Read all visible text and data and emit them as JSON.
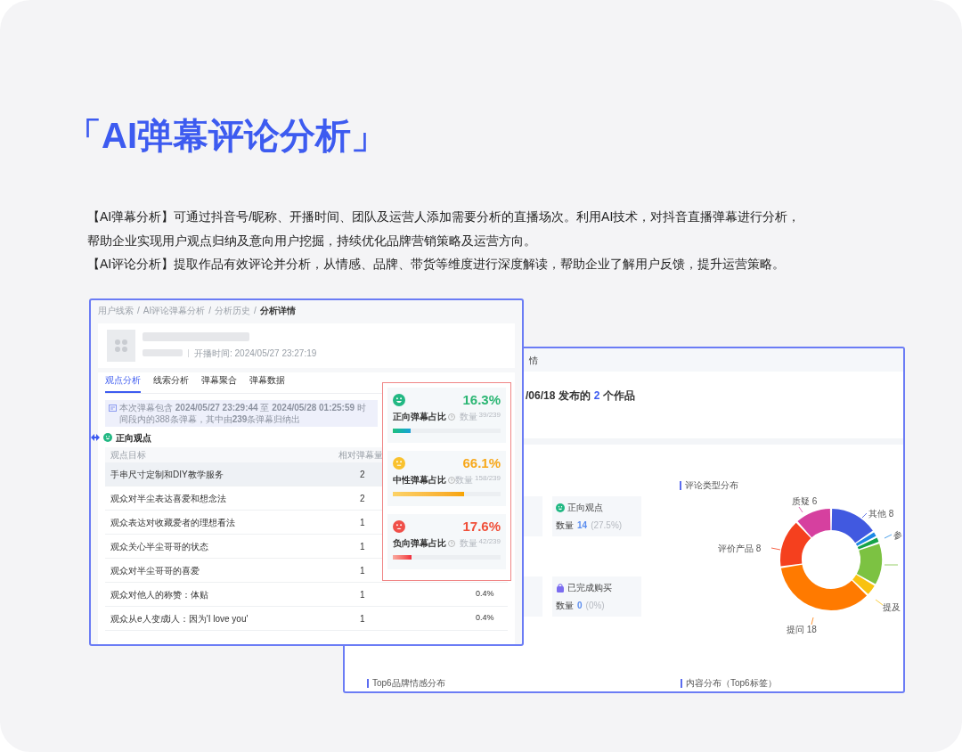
{
  "heading": "「AI弹幕评论分析」",
  "paragraphs": [
    "【AI弹幕分析】可通过抖音号/昵称、开播时间、团队及运营人添加需要分析的直播场次。利用AI技术，对抖音直播弹幕进行分析，帮助企业实现用户观点归纳及意向用户挖掘，持续优化品牌营销策略及运营方向。",
    "【AI评论分析】提取作品有效评论并分析，从情感、品牌、带货等维度进行深度解读，帮助企业了解用户反馈，提升运营策略。"
  ],
  "danmaku_window": {
    "breadcrumb": [
      {
        "label": "用户线索",
        "separator": "/"
      },
      {
        "label": "AI评论弹幕分析",
        "separator": "/"
      },
      {
        "label": "分析历史",
        "separator": "/"
      },
      {
        "label": "分析详情"
      }
    ],
    "live_time": "开播时间: 2024/05/27 23:27:19",
    "tabs": [
      {
        "label": "观点分析",
        "selected": true
      },
      {
        "label": "线索分析",
        "selected": false
      },
      {
        "label": "弹幕聚合",
        "selected": false
      },
      {
        "label": "弹幕数据",
        "selected": false
      }
    ],
    "notice": "本次弹幕包含 **2024/05/27 23:29:44** 至 **2024/05/28 01:25:59** 时间段内的388条弹幕，其中由**239**条弹幕归纳出",
    "section": "正向观点",
    "table": {
      "columns": [
        "观点目标",
        "相对弹幕量"
      ],
      "rows": [
        {
          "target": "手串尺寸定制和DIY教学服务",
          "count": "2",
          "selected": true
        },
        {
          "target": "观众对半尘表达喜爱和想念法",
          "count": "2",
          "selected": false
        },
        {
          "target": "观众表达对收藏爱者的理想看法",
          "count": "1",
          "selected": false
        },
        {
          "target": "观众关心半尘哥哥的状态",
          "count": "1",
          "selected": false
        },
        {
          "target": "观众对半尘哥哥的喜爱",
          "count": "1",
          "selected": false
        },
        {
          "target": "观众对他人的称赞：体贴",
          "count": "1",
          "share": "0.4%",
          "selected": false
        },
        {
          "target": "观众从e人变成i人：因为'I love you'",
          "count": "1",
          "share": "0.4%",
          "selected": false
        }
      ]
    },
    "sentiments": [
      {
        "kind": "positive",
        "label": "正向弹幕占比",
        "percent": "16.3%",
        "count_label": "数量",
        "count": "39/239",
        "level": 0.163
      },
      {
        "kind": "neutral",
        "label": "中性弹幕占比",
        "percent": "66.1%",
        "count_label": "数量",
        "count": "158/239",
        "level": 0.661
      },
      {
        "kind": "negative",
        "label": "负向弹幕占比",
        "percent": "17.6%",
        "count_label": "数量",
        "count": "42/239",
        "level": 0.176
      }
    ]
  },
  "comment_window": {
    "header_title": "情",
    "headline": {
      "prefix": "/06/18 发布的",
      "count": "2",
      "suffix": "个作品"
    },
    "stats": [
      {
        "kind": "positive",
        "label": "正向观点",
        "count_label": "数量",
        "value": "14",
        "share": "(27.5%)"
      },
      {
        "kind": "purchase",
        "label": "已完成购买",
        "count_label": "数量",
        "value": "0",
        "share": "(0%)"
      }
    ],
    "chart_title": "评论类型分布",
    "chart_labels": [
      "其他 8",
      "参",
      "提及",
      "提问 18",
      "评价产品 8",
      "质疑 6"
    ],
    "bottom_titles": [
      "Top6品牌情感分布",
      "内容分布（Top6标签）"
    ]
  }
}
